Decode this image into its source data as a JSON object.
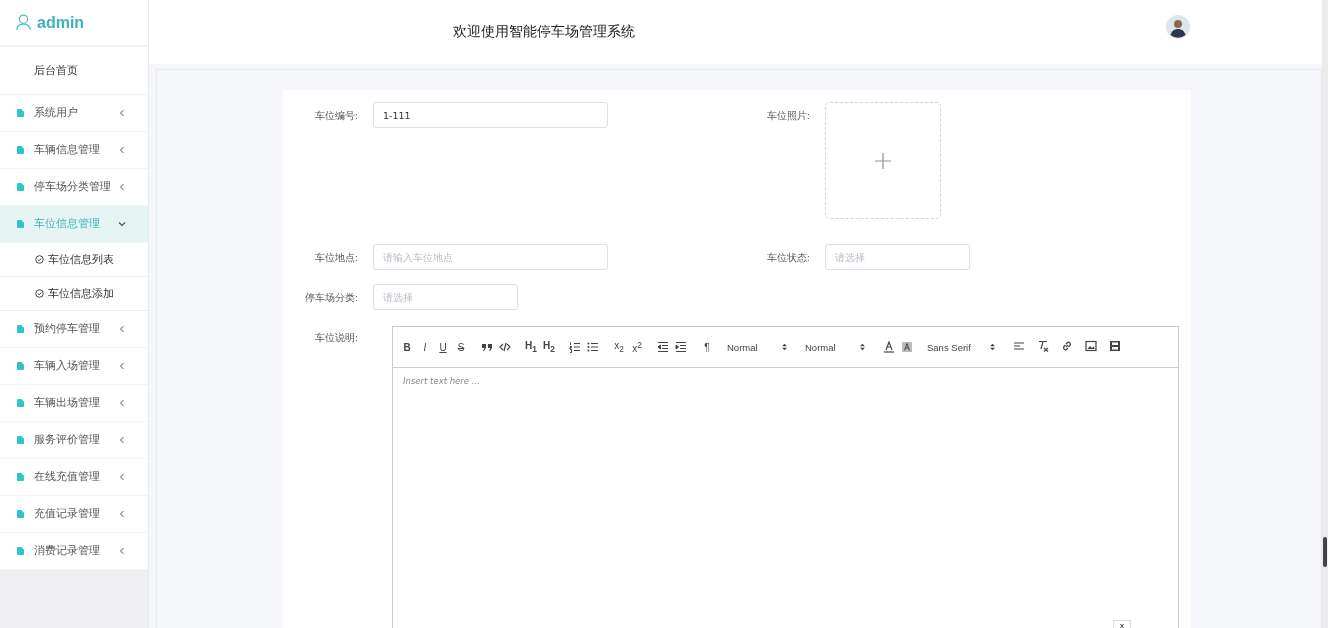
{
  "sidebar": {
    "user": "admin",
    "home": "后台首页",
    "items": [
      {
        "label": "系统用户",
        "selected": false,
        "expanded": false
      },
      {
        "label": "车辆信息管理",
        "selected": false,
        "expanded": false
      },
      {
        "label": "停车场分类管理",
        "selected": false,
        "expanded": false
      },
      {
        "label": "车位信息管理",
        "selected": true,
        "expanded": true,
        "children": [
          {
            "label": "车位信息列表"
          },
          {
            "label": "车位信息添加"
          }
        ]
      },
      {
        "label": "预约停车管理",
        "selected": false,
        "expanded": false
      },
      {
        "label": "车辆入场管理",
        "selected": false,
        "expanded": false
      },
      {
        "label": "车辆出场管理",
        "selected": false,
        "expanded": false
      },
      {
        "label": "服务评价管理",
        "selected": false,
        "expanded": false
      },
      {
        "label": "在线充值管理",
        "selected": false,
        "expanded": false
      },
      {
        "label": "充值记录管理",
        "selected": false,
        "expanded": false
      },
      {
        "label": "消费记录管理",
        "selected": false,
        "expanded": false
      }
    ]
  },
  "header": {
    "title": "欢迎使用智能停车场管理系统"
  },
  "form": {
    "number": {
      "label": "车位编号:",
      "value": "1-111"
    },
    "photo": {
      "label": "车位照片:"
    },
    "location": {
      "label": "车位地点:",
      "placeholder": "请输入车位地点"
    },
    "status": {
      "label": "车位状态:",
      "placeholder": "请选择"
    },
    "category": {
      "label": "停车场分类:",
      "placeholder": "请选择"
    },
    "description": {
      "label": "车位说明:"
    }
  },
  "editor": {
    "format_buttons": [
      "B",
      "I",
      "U",
      "S"
    ],
    "heading_buttons": [
      "H$_{1}$",
      "H$_{2}$"
    ],
    "script_buttons": [
      "x$_{2}$",
      "x$^{2}$"
    ],
    "direction_button": "¶",
    "selects": [
      "Normal",
      "Normal",
      "Sans Serif"
    ],
    "placeholder": "Insert text here ...",
    "close_label": "x"
  }
}
